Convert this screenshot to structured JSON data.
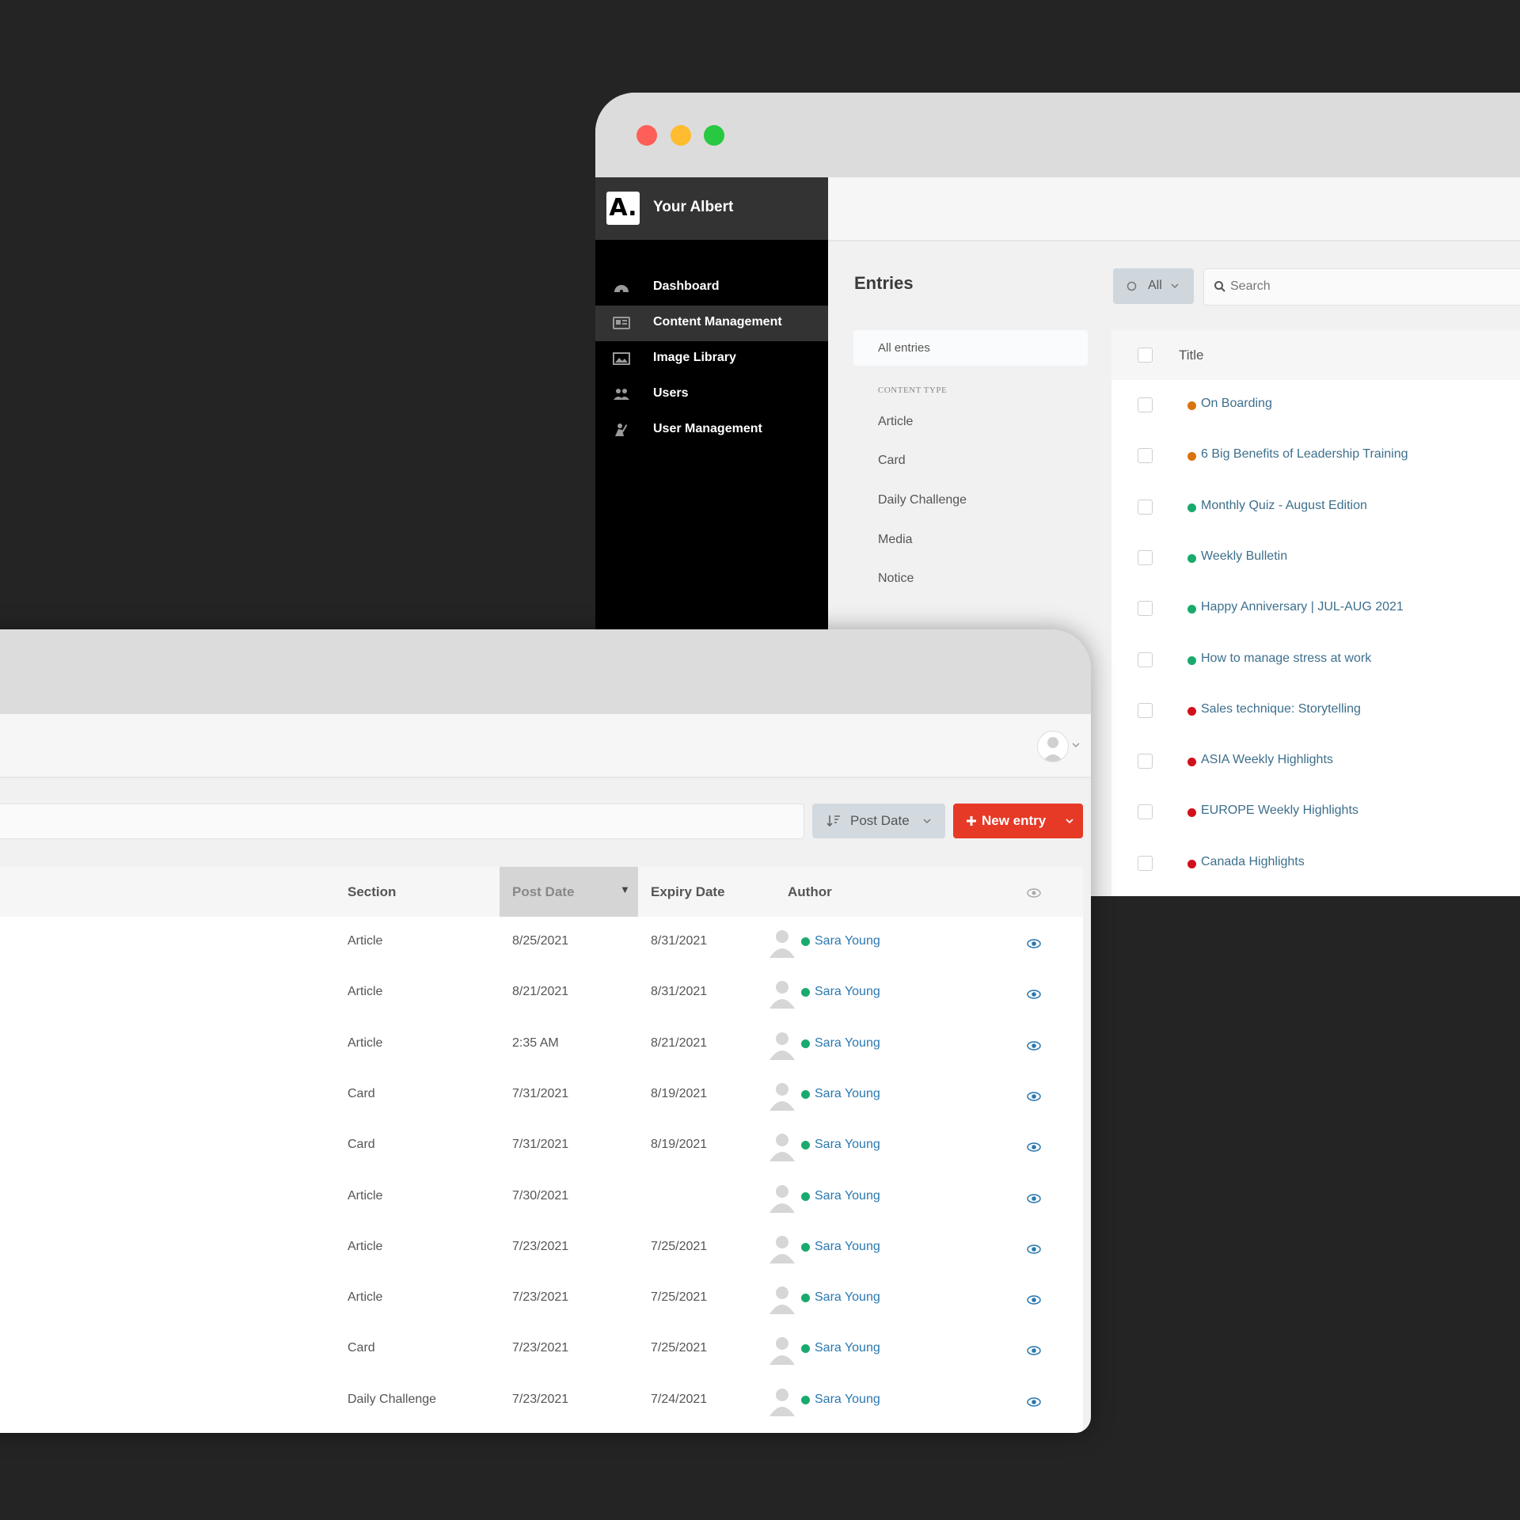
{
  "colors": {
    "background": "#242424",
    "traffic_red": "#fe5f57",
    "traffic_yellow": "#febc2e",
    "traffic_green": "#28c840",
    "accent_red": "#e63a27",
    "status_orange": "#d9730d",
    "status_green": "#1aaa6e",
    "status_red": "#d0111b",
    "link_blue": "#3d6f8c"
  },
  "app": {
    "brand_logo": "A.",
    "brand_name": "Your Albert"
  },
  "sidebar": {
    "items": [
      {
        "label": "Dashboard",
        "icon": "dashboard-icon",
        "active": false
      },
      {
        "label": "Content Management",
        "icon": "content-management-icon",
        "active": true
      },
      {
        "label": "Image Library",
        "icon": "image-icon",
        "active": false
      },
      {
        "label": "Users",
        "icon": "users-icon",
        "active": false
      },
      {
        "label": "User Management",
        "icon": "user-management-icon",
        "active": false
      }
    ]
  },
  "entries": {
    "heading": "Entries",
    "filter_label": "All",
    "search_placeholder": "Search",
    "all_entries_label": "All entries",
    "content_type_heading": "CONTENT TYPE",
    "content_types": [
      "Article",
      "Card",
      "Daily Challenge",
      "Media",
      "Notice"
    ],
    "title_header": "Title",
    "rows": [
      {
        "title": "On Boarding",
        "status": "orange"
      },
      {
        "title": "6 Big Benefits of Leadership Training",
        "status": "orange"
      },
      {
        "title": "Monthly Quiz - August Edition",
        "status": "green"
      },
      {
        "title": "Weekly Bulletin",
        "status": "green"
      },
      {
        "title": "Happy Anniversary | JUL-AUG 2021",
        "status": "green"
      },
      {
        "title": "How to manage stress at work",
        "status": "green"
      },
      {
        "title": "Sales technique: Storytelling",
        "status": "red"
      },
      {
        "title": "ASIA Weekly Highlights",
        "status": "red"
      },
      {
        "title": "EUROPE Weekly Highlights",
        "status": "red"
      },
      {
        "title": "Canada Highlights",
        "status": "red"
      }
    ]
  },
  "toolbar": {
    "sort_label": "Post Date",
    "new_entry_label": "New entry"
  },
  "table": {
    "columns": {
      "section": "Section",
      "post_date": "Post Date",
      "expiry_date": "Expiry Date",
      "author": "Author"
    },
    "sort_indicator": "▼",
    "rows": [
      {
        "section": "Article",
        "post_date": "8/25/2021",
        "expiry_date": "8/31/2021",
        "author": "Sara Young"
      },
      {
        "section": "Article",
        "post_date": "8/21/2021",
        "expiry_date": "8/31/2021",
        "author": "Sara Young"
      },
      {
        "section": "Article",
        "post_date": "2:35 AM",
        "expiry_date": "8/21/2021",
        "author": "Sara Young"
      },
      {
        "section": "Card",
        "post_date": "7/31/2021",
        "expiry_date": "8/19/2021",
        "author": "Sara Young"
      },
      {
        "section": "Card",
        "post_date": "7/31/2021",
        "expiry_date": "8/19/2021",
        "author": "Sara Young"
      },
      {
        "section": "Article",
        "post_date": "7/30/2021",
        "expiry_date": "",
        "author": "Sara Young"
      },
      {
        "section": "Article",
        "post_date": "7/23/2021",
        "expiry_date": "7/25/2021",
        "author": "Sara Young"
      },
      {
        "section": "Article",
        "post_date": "7/23/2021",
        "expiry_date": "7/25/2021",
        "author": "Sara Young"
      },
      {
        "section": "Card",
        "post_date": "7/23/2021",
        "expiry_date": "7/25/2021",
        "author": "Sara Young"
      },
      {
        "section": "Daily Challenge",
        "post_date": "7/23/2021",
        "expiry_date": "7/24/2021",
        "author": "Sara Young"
      }
    ]
  }
}
